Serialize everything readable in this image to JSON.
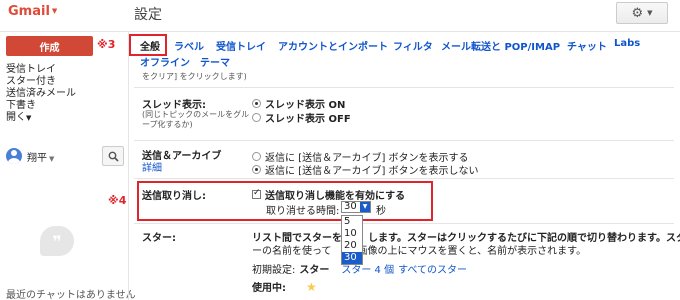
{
  "header": {
    "brand": "Gmail",
    "title": "設定"
  },
  "compose_label": "作成",
  "annotations": {
    "tabs": "※3",
    "undo": "※4"
  },
  "nav": [
    "受信トレイ",
    "スター付き",
    "送信済みメール",
    "下書き",
    "開く"
  ],
  "chat": {
    "user": "翔平",
    "empty_message": "最近のチャットはありません"
  },
  "tabs": [
    "全般",
    "ラベル",
    "受信トレイ",
    "アカウントとインポート",
    "フィルタ",
    "メール転送と POP/IMAP",
    "チャット",
    "Labs",
    "オフライン",
    "テーマ"
  ],
  "settings": {
    "cut_note": "をクリア] をクリックします)",
    "thread": {
      "label": "スレッド表示:",
      "sub": "(同じトピックのメールをグループ化するか)",
      "on": "スレッド表示 ON",
      "off": "スレッド表示 OFF"
    },
    "archive": {
      "label": "送信＆アーカイブ",
      "link": "詳細",
      "show": "返信に [送信＆アーカイブ] ボタンを表示する",
      "hide": "返信に [送信＆アーカイブ] ボタンを表示しない"
    },
    "undo": {
      "label": "送信取り消し:",
      "enable": "送信取り消し機能を有効にする",
      "period_label": "取り消せる時間:",
      "period_value": "30",
      "unit": "秒",
      "options": [
        "5",
        "10",
        "20",
        "30"
      ]
    },
    "stars": {
      "label": "スター:",
      "desc1_a": "リスト間でスターを",
      "desc1_b": "します。スターはクリックするたびに下記の順で切り替わります。スタ",
      "desc2_a": "ーの名前を使って",
      "desc2_b": "画像の上にマウスを置くと、名前が表示されます。",
      "preset_label": "初期設定:",
      "preset_1": "スター",
      "preset_4": "スター 4 個",
      "preset_all": "すべてのスター",
      "in_use": "使用中:"
    }
  }
}
